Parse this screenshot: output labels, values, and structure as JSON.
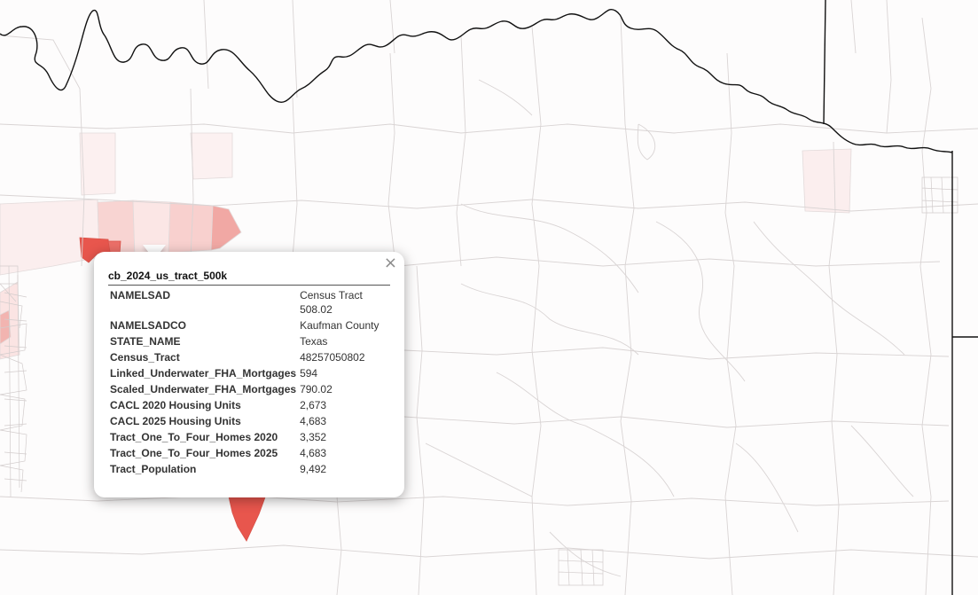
{
  "map": {
    "colors": {
      "background": "#fdfcfc",
      "tract_border": "#d9d4d4",
      "state_border": "#111111",
      "highlight_strong": "#e8564d",
      "highlight_medium": "#f1a8a4",
      "highlight_light": "#f7d9d7"
    }
  },
  "popup": {
    "title": "cb_2024_us_tract_500k",
    "close_symbol": "×",
    "rows": [
      {
        "key": "NAMELSAD",
        "value": "Census Tract 508.02"
      },
      {
        "key": "NAMELSADCO",
        "value": "Kaufman County"
      },
      {
        "key": "STATE_NAME",
        "value": "Texas"
      },
      {
        "key": "Census_Tract",
        "value": "48257050802"
      },
      {
        "key": "Linked_Underwater_FHA_Mortgages",
        "value": "594"
      },
      {
        "key": "Scaled_Underwater_FHA_Mortgages",
        "value": "790.02"
      },
      {
        "key": "CACL 2020 Housing Units",
        "value": "2,673"
      },
      {
        "key": "CACL 2025 Housing Units",
        "value": "4,683"
      },
      {
        "key": "Tract_One_To_Four_Homes 2020",
        "value": "3,352"
      },
      {
        "key": "Tract_One_To_Four_Homes 2025",
        "value": "4,683"
      },
      {
        "key": "Tract_Population",
        "value": "9,492"
      }
    ]
  }
}
